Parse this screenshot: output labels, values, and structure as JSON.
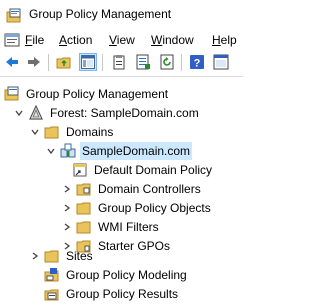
{
  "window": {
    "title": "Group Policy Management"
  },
  "menu": {
    "items": [
      {
        "label": "File",
        "accel": "F",
        "rest": "ile"
      },
      {
        "label": "Action",
        "accel": "A",
        "rest": "ction"
      },
      {
        "label": "View",
        "accel": "V",
        "rest": "iew"
      },
      {
        "label": "Window",
        "accel": "W",
        "rest": "indow"
      },
      {
        "label": "Help",
        "accel": "H",
        "rest": "elp"
      }
    ]
  },
  "toolbar": {
    "buttons": [
      "back-icon",
      "forward-icon",
      "up-folder-icon",
      "show-hide-tree-icon",
      "properties-icon",
      "export-list-icon",
      "refresh-icon",
      "help-icon",
      "mmc-help-icon"
    ]
  },
  "tree": {
    "root": "Group Policy Management",
    "forest": "Forest: SampleDomain.com",
    "domains": "Domains",
    "domain": "SampleDomain.com",
    "default_policy": "Default Domain Policy",
    "domain_controllers": "Domain Controllers",
    "gpo": "Group Policy Objects",
    "wmi": "WMI Filters",
    "starter": "Starter GPOs",
    "sites": "Sites",
    "modeling": "Group Policy Modeling",
    "results": "Group Policy Results"
  },
  "colors": {
    "selection": "#cce8ff",
    "folder": "#e9c45a",
    "accent": "#1e78d7"
  }
}
